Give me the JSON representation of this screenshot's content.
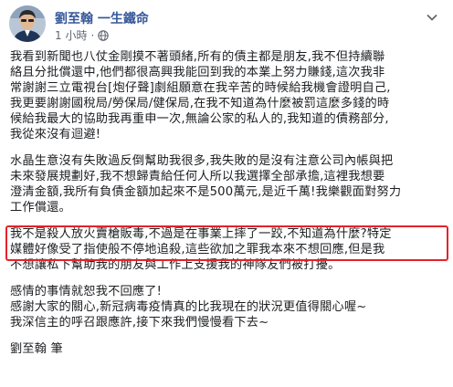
{
  "post": {
    "author": "劉至翰 一生鐵命",
    "time": "1 小時",
    "time_sep": "·",
    "more_icon": "chevron-down-icon",
    "globe_icon": "globe-icon",
    "paragraphs": [
      [
        "我看到新聞也八仗金剛摸不著頭緒,所有的債主都是朋友,我不但持續聯",
        "絡且分批償還中,他們都很高興我能回到我的本業上努力賺錢,這次我非",
        "常謝謝三立電視台[炮仔聲]劇組願意在我辛苦的時候給我機會證明自己,",
        "我更要謝謝國稅局/勞保局/健保局,在我不知道為什麼被罰這麼多錢的時",
        "候給我最大的協助我再重申一次,無論公家的私人的,我知道的債務部分,",
        "我從來沒有迴避!"
      ],
      [
        "水晶生意沒有失敗過反倒幫助我很多,我失敗的是沒有注意公司內帳與把",
        "未來發展規劃好,我不想歸責給任何人所以我選擇全部承擔,這裡我想要",
        "澄清金額,我所有負債金額加起來不是500萬元,是近千萬!我樂觀面對努力",
        "工作償還。"
      ],
      [
        "我不是殺人放火賣槍販毒,不過是在事業上摔了一跤,不知道為什麼?特定",
        "媒體好像受了指使般不停地追殺,這些欲加之罪我本來不想回應,但是我",
        "不想讓私下幫助我的朋友與工作上支援我的神隊友們被打擾。"
      ],
      [
        "感情的事情就恕我不回應了!",
        "感謝大家的關心,新冠病毒疫情真的比我現在的狀況更值得關心喔~",
        "我深信主的呼召跟應許,接下來我們慢慢看下去~"
      ],
      [
        "劉至翰 筆"
      ]
    ]
  },
  "colors": {
    "author": "#365899",
    "highlight_border": "#e4232a"
  }
}
